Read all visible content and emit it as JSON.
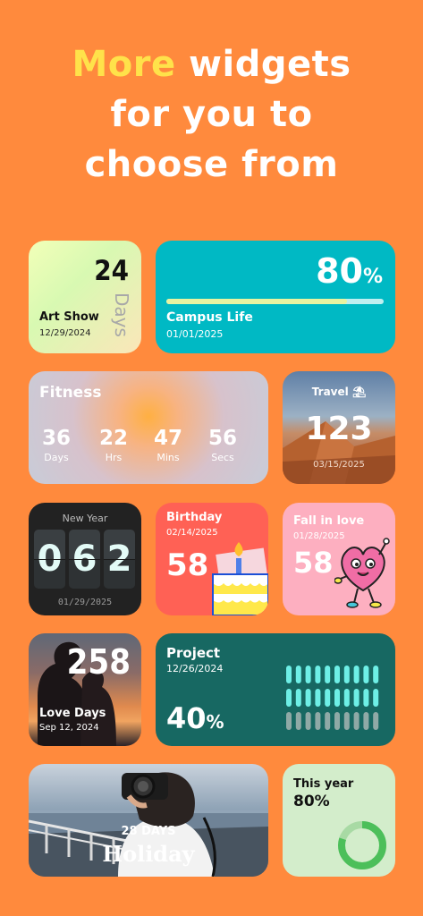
{
  "headline": {
    "highlight": "More",
    "line1_rest": " widgets",
    "line2": "for you to",
    "line3": "choose from"
  },
  "colors": {
    "background": "#FF8A3D",
    "highlight": "#FFE24A"
  },
  "widgets": {
    "art_show": {
      "number": "24",
      "unit": "Days",
      "title": "Art Show",
      "date": "12/29/2024"
    },
    "campus_life": {
      "percent_value": "80",
      "percent_sign": "%",
      "progress": 0.83,
      "title": "Campus Life",
      "date": "01/01/2025"
    },
    "fitness": {
      "title": "Fitness",
      "countdown": [
        {
          "value": "36",
          "label": "Days"
        },
        {
          "value": "22",
          "label": "Hrs"
        },
        {
          "value": "47",
          "label": "Mins"
        },
        {
          "value": "56",
          "label": "Secs"
        }
      ]
    },
    "travel": {
      "title": "Travel",
      "number": "123",
      "date": "03/15/2025"
    },
    "new_year": {
      "title": "New Year",
      "digits": [
        "0",
        "6",
        "2"
      ],
      "date": "01/29/2025"
    },
    "birthday": {
      "title": "Birthday",
      "date": "02/14/2025",
      "number": "58"
    },
    "fall_in_love": {
      "title": "Fall in love",
      "date": "01/28/2025",
      "number": "58"
    },
    "love_days": {
      "number": "258",
      "title": "Love Days",
      "date": "Sep 12, 2024"
    },
    "project": {
      "title": "Project",
      "date": "12/26/2024",
      "percent_value": "40",
      "percent_sign": "%",
      "grid_filled_rows": 2,
      "grid_total_rows": 3
    },
    "holiday": {
      "days": "28 DAYS",
      "title": "Holiday"
    },
    "this_year": {
      "title": "This year",
      "percent": "80%",
      "progress": 0.8
    }
  }
}
